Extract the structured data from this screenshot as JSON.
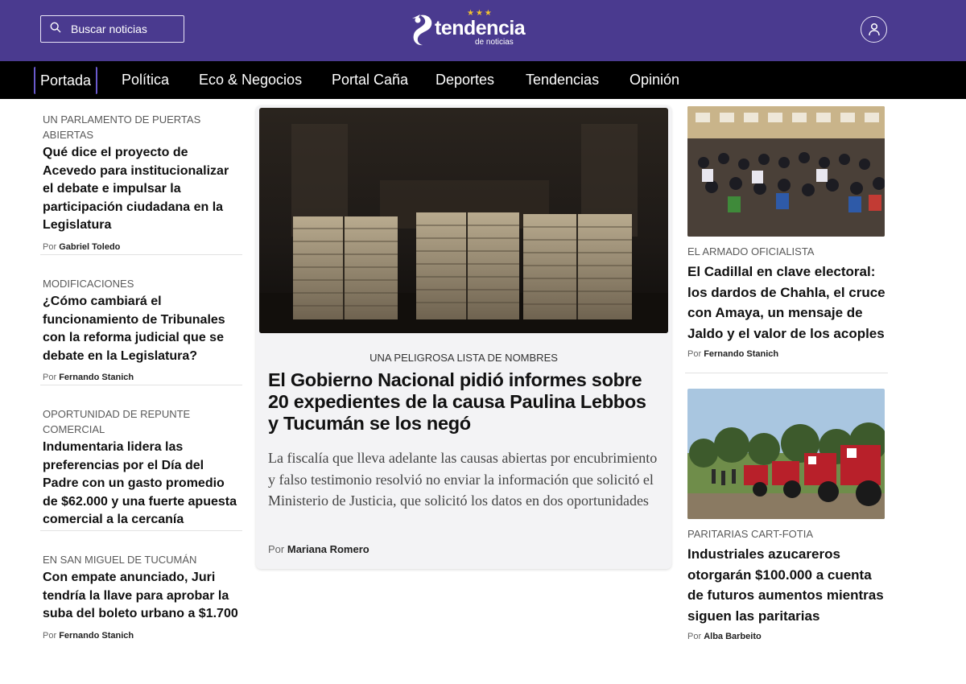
{
  "header": {
    "search_placeholder": "Buscar noticias",
    "brand_name": "tendencia",
    "brand_subtitle": "de noticias",
    "brand_stars": "★★★",
    "colors": {
      "header_bg": "#4a3a8f",
      "nav_bg": "#000000",
      "accent": "#6a5acd",
      "stars": "#f2c230"
    }
  },
  "nav": {
    "items": [
      "Portada",
      "Política",
      "Eco & Negocios",
      "Portal Caña",
      "Deportes",
      "Tendencias",
      "Opinión"
    ],
    "active": "Portada"
  },
  "by_prefix": "Por",
  "left_articles": [
    {
      "kicker": "UN PARLAMENTO DE PUERTAS ABIERTAS",
      "headline": "Qué dice el proyecto de Acevedo para institucionalizar el debate e impulsar la participación ciudadana en la Legislatura",
      "author": "Gabriel Toledo"
    },
    {
      "kicker": "MODIFICACIONES",
      "headline": "¿Cómo cambiará el funcionamiento de Tribunales con la reforma judicial que se debate en la Legislatura?",
      "author": "Fernando Stanich"
    },
    {
      "kicker": "OPORTUNIDAD DE REPUNTE COMERCIAL",
      "headline": "Indumentaria lidera las preferencias por el Día del Padre con un gasto promedio de $62.000 y una fuerte apuesta comercial a la cercanía",
      "author": ""
    },
    {
      "kicker": "EN SAN MIGUEL DE TUCUMÁN",
      "headline": "Con empate anunciado, Juri tendría la llave para aprobar la suba del boleto urbano a $1.700",
      "author": "Fernando Stanich"
    }
  ],
  "main_article": {
    "kicker": "UNA PELIGROSA LISTA DE NOMBRES",
    "headline": "El Gobierno Nacional pidió informes sobre 20 expedientes de la causa Paulina Lebbos y Tucumán se los negó",
    "summary": "La fiscalía que lleva adelante las causas abiertas por encubrimiento y falso testimonio resolvió no enviar la información que solicitó el Ministerio de Justicia, que solicitó los datos en dos oportunidades",
    "author": "Mariana Romero"
  },
  "right_articles": [
    {
      "kicker": "EL ARMADO OFICIALISTA",
      "headline": "El Cadillal en clave electoral: los dardos de Chahla, el cruce con Amaya, un mensaje de Jaldo y el valor de los acoples",
      "author": "Fernando Stanich"
    },
    {
      "kicker": "PARITARIAS CART-FOTIA",
      "headline": "Industriales azucareros otorgarán $100.000 a cuenta de futuros aumentos mientras siguen las paritarias",
      "author": "Alba Barbeito"
    }
  ]
}
